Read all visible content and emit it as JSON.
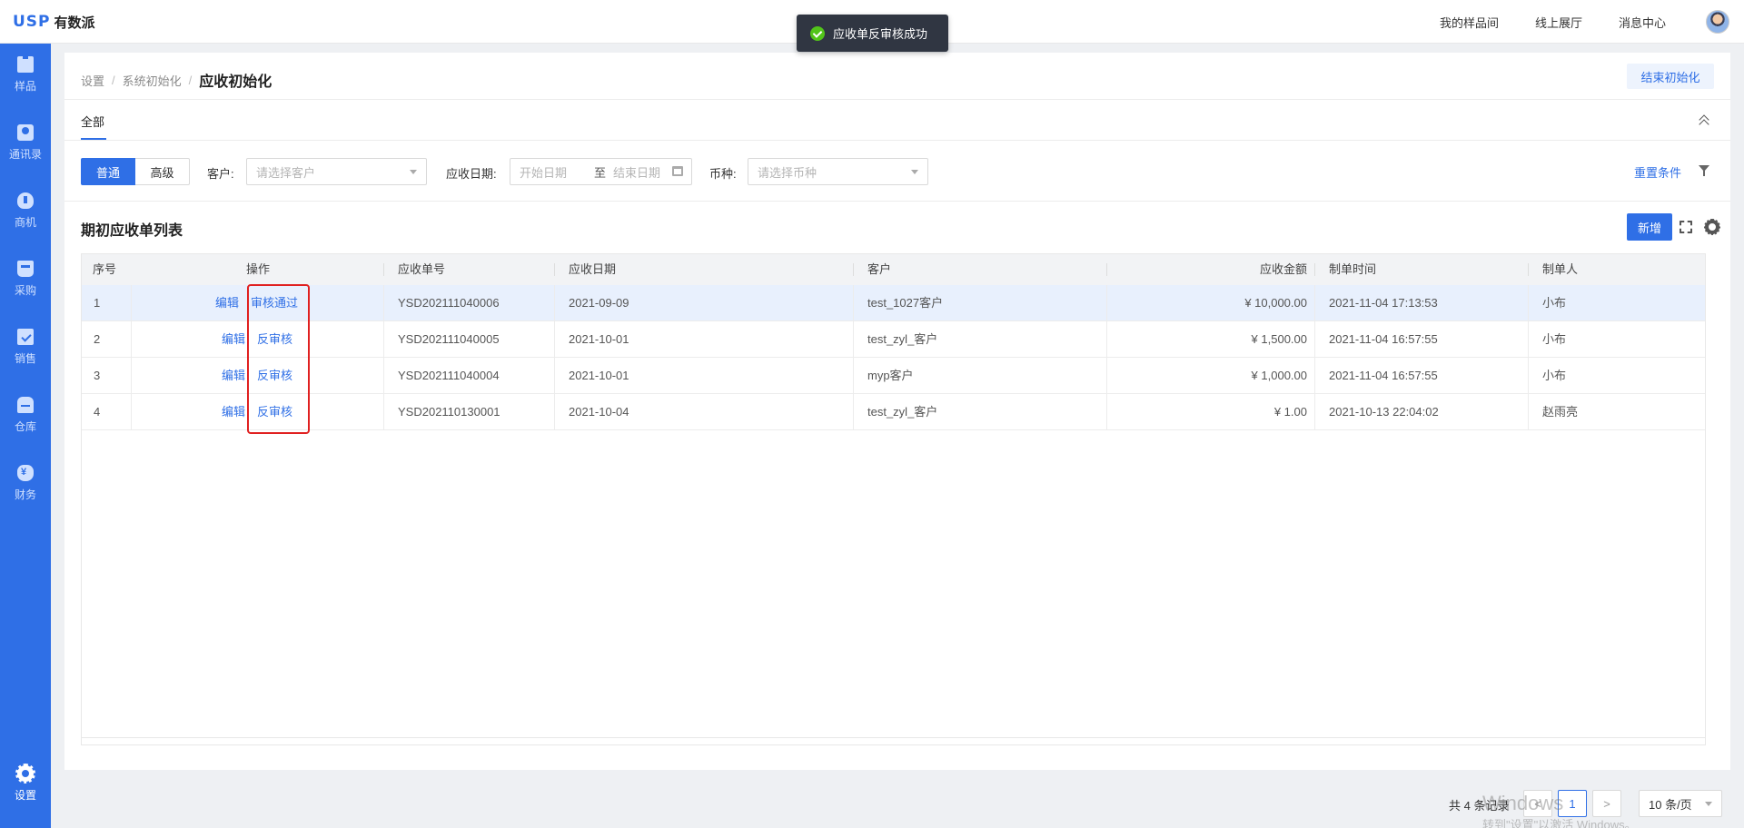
{
  "header": {
    "logo_mark": "USP",
    "logo_name": "有数派",
    "nav": [
      "我的样品间",
      "线上展厅",
      "消息中心"
    ]
  },
  "toast": {
    "message": "应收单反审核成功"
  },
  "sidebar": {
    "items": [
      {
        "label": "样品",
        "icon": "box-icon"
      },
      {
        "label": "通讯录",
        "icon": "contact-icon"
      },
      {
        "label": "商机",
        "icon": "bulb-icon"
      },
      {
        "label": "采购",
        "icon": "cart-icon"
      },
      {
        "label": "销售",
        "icon": "clipboard-icon"
      },
      {
        "label": "仓库",
        "icon": "warehouse-icon"
      },
      {
        "label": "财务",
        "icon": "money-bag-icon"
      }
    ],
    "settings_label": "设置"
  },
  "breadcrumb": {
    "items": [
      "设置",
      "系统初始化"
    ],
    "current": "应收初始化"
  },
  "end_init_label": "结束初始化",
  "tab_all": "全部",
  "filters": {
    "mode_normal": "普通",
    "mode_advanced": "高级",
    "customer_label": "客户:",
    "customer_placeholder": "请选择客户",
    "date_label": "应收日期:",
    "start_placeholder": "开始日期",
    "range_sep": "至",
    "end_placeholder": "结束日期",
    "currency_label": "币种:",
    "currency_placeholder": "请选择币种",
    "reset_label": "重置条件"
  },
  "list": {
    "title": "期初应收单列表",
    "add_label": "新增",
    "columns": [
      "序号",
      "操作",
      "应收单号",
      "应收日期",
      "客户",
      "应收金额",
      "制单时间",
      "制单人"
    ],
    "rows": [
      {
        "no": "1",
        "edit": "编辑",
        "action": "审核通过",
        "bill": "YSD202111040006",
        "date": "2021-09-09",
        "customer": "test_1027客户",
        "amount": "¥ 10,000.00",
        "created": "2021-11-04 17:13:53",
        "creator": "小布"
      },
      {
        "no": "2",
        "edit": "编辑",
        "action": "反审核",
        "bill": "YSD202111040005",
        "date": "2021-10-01",
        "customer": "test_zyl_客户",
        "amount": "¥ 1,500.00",
        "created": "2021-11-04 16:57:55",
        "creator": "小布"
      },
      {
        "no": "3",
        "edit": "编辑",
        "action": "反审核",
        "bill": "YSD202111040004",
        "date": "2021-10-01",
        "customer": "myp客户",
        "amount": "¥ 1,000.00",
        "created": "2021-11-04 16:57:55",
        "creator": "小布"
      },
      {
        "no": "4",
        "edit": "编辑",
        "action": "反审核",
        "bill": "YSD202110130001",
        "date": "2021-10-04",
        "customer": "test_zyl_客户",
        "amount": "¥ 1.00",
        "created": "2021-10-13 22:04:02",
        "creator": "赵雨亮"
      }
    ]
  },
  "pagination": {
    "total_text": "共 4 条记录",
    "current_page": "1",
    "page_size": "10 条/页"
  },
  "watermark": {
    "line1": "Windows",
    "line2": "转到\"设置\"以激活 Windows。"
  }
}
